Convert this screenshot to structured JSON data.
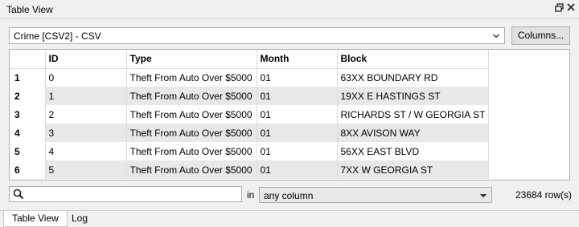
{
  "window": {
    "title": "Table View"
  },
  "dataset": {
    "selected": "Crime [CSV2] - CSV"
  },
  "columns_button": "Columns...",
  "table": {
    "headers": [
      "ID",
      "Type",
      "Month",
      "Block"
    ],
    "rows": [
      {
        "num": "1",
        "cells": [
          "0",
          "Theft From Auto Over $5000",
          "01",
          "63XX BOUNDARY RD"
        ]
      },
      {
        "num": "2",
        "cells": [
          "1",
          "Theft From Auto Over $5000",
          "01",
          "19XX E HASTINGS ST"
        ]
      },
      {
        "num": "3",
        "cells": [
          "2",
          "Theft From Auto Over $5000",
          "01",
          "RICHARDS ST / W GEORGIA ST"
        ]
      },
      {
        "num": "4",
        "cells": [
          "3",
          "Theft From Auto Over $5000",
          "01",
          "8XX AVISON WAY"
        ]
      },
      {
        "num": "5",
        "cells": [
          "4",
          "Theft From Auto Over $5000",
          "01",
          "56XX EAST BLVD"
        ]
      },
      {
        "num": "6",
        "cells": [
          "5",
          "Theft From Auto Over $5000",
          "01",
          "7XX W GEORGIA ST"
        ]
      }
    ]
  },
  "search": {
    "value": "",
    "in_label": "in",
    "column_option": "any column",
    "row_count": "23684 row(s)"
  },
  "tabs": [
    "Table View",
    "Log"
  ],
  "icons": {
    "float": "float-window-icon",
    "close": "close-icon",
    "search": "search-icon"
  }
}
